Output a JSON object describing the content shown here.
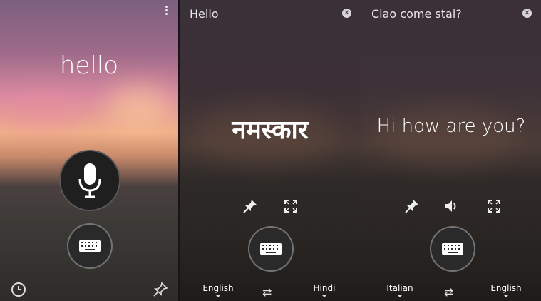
{
  "panel1": {
    "phrase": "hello",
    "icons": {
      "menu": "more-vert-icon",
      "mic": "microphone-icon",
      "keyboard": "keyboard-icon",
      "history": "history-icon",
      "pin": "pin-icon"
    }
  },
  "panel2": {
    "source": "Hello",
    "translation": "नमस्कार",
    "source_lang": "English",
    "target_lang": "Hindi",
    "icons": {
      "close": "close-icon",
      "pin": "pin-icon",
      "fullscreen": "fullscreen-icon",
      "keyboard": "keyboard-icon",
      "swap": "swap-icon"
    }
  },
  "panel3": {
    "source_prefix": "Ciao come ",
    "source_highlight": "stai",
    "source_suffix": "?",
    "translation": "Hi how are you?",
    "source_lang": "Italian",
    "target_lang": "English",
    "icons": {
      "close": "close-icon",
      "pin": "pin-icon",
      "speaker": "speaker-icon",
      "fullscreen": "fullscreen-icon",
      "keyboard": "keyboard-icon",
      "swap": "swap-icon"
    }
  },
  "colors": {
    "spellcheck_underline": "#e53935"
  }
}
